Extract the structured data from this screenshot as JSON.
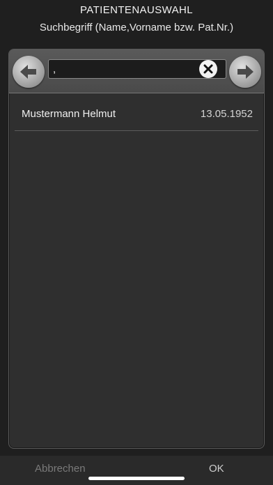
{
  "header": {
    "title": "PATIENTENAUSWAHL",
    "subtitle": "Suchbegriff (Name,Vorname bzw. Pat.Nr.)"
  },
  "search": {
    "value": ",",
    "left_icon": "arrow-left-icon",
    "right_icon": "arrow-right-icon",
    "clear_icon": "close-icon"
  },
  "results": [
    {
      "name": "Mustermann Helmut",
      "date": "13.05.1952"
    }
  ],
  "footer": {
    "cancel_label": "Abbrechen",
    "ok_label": "OK"
  },
  "colors": {
    "background": "#1f1f1f",
    "panel": "#2f2f2f",
    "cancel_text": "#7a7a7a"
  }
}
